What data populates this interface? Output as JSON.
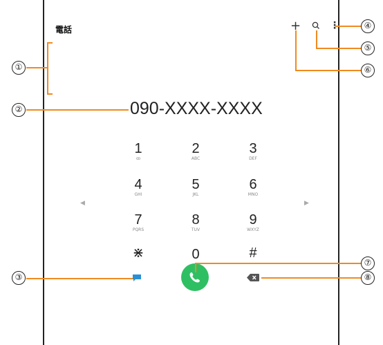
{
  "header": {
    "title": "電話",
    "add_icon": "plus-icon",
    "search_icon": "search-icon",
    "more_icon": "more-options-icon"
  },
  "display": {
    "number": "090-XXXX-XXXX"
  },
  "keypad": [
    {
      "digit": "1",
      "letters": "ꝏ"
    },
    {
      "digit": "2",
      "letters": "ABC"
    },
    {
      "digit": "3",
      "letters": "DEF"
    },
    {
      "digit": "4",
      "letters": "GHI"
    },
    {
      "digit": "5",
      "letters": "JKL"
    },
    {
      "digit": "6",
      "letters": "MNO"
    },
    {
      "digit": "7",
      "letters": "PQRS"
    },
    {
      "digit": "8",
      "letters": "TUV"
    },
    {
      "digit": "9",
      "letters": "WXYZ"
    },
    {
      "digit": "⋇",
      "letters": ""
    },
    {
      "digit": "0",
      "letters": "+"
    },
    {
      "digit": "#",
      "letters": ""
    }
  ],
  "actions": {
    "message_icon": "message-icon",
    "call_icon": "phone-icon",
    "backspace_icon": "backspace-icon"
  },
  "callouts": [
    "①",
    "②",
    "③",
    "④",
    "⑤",
    "⑥",
    "⑦",
    "⑧"
  ],
  "colors": {
    "accent": "#f08a1e",
    "call": "#2fbf63",
    "message": "#2b8fd6"
  }
}
